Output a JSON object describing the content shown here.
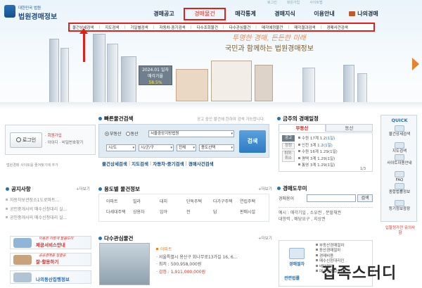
{
  "header": {
    "logo_small": "대한민국 법원",
    "logo_big": "법원경매정보",
    "top_links": [
      "로그인",
      "회원가입",
      "사이트맵"
    ],
    "gnb": [
      "경매공고",
      "경매물건",
      "매각통계",
      "경매지식",
      "이용안내",
      "나의경매"
    ],
    "active_gnb": "경매물건",
    "submenu": [
      "물건상세검색",
      "지도검색",
      "기일별검색",
      "자동차·중기검색",
      "다수조회물건",
      "다수관심물건",
      "매각예정물건",
      "매각결과검색",
      "경매사건검색"
    ],
    "slogan1": "투명한 경매, 든든한 미래",
    "slogan2": "국민과 함께하는 법원경매정보",
    "date_panel": {
      "date": "2024.01 일자",
      "label": "매각가율",
      "value": "58.5%"
    },
    "accent_color": "#e0201a"
  },
  "login": {
    "button": "로그인",
    "join": "· 회원가입",
    "find": "· 아이디 · 비밀번호찾기",
    "note": "법원경매 사이트를 즐겨찾기에 추가"
  },
  "quick_search": {
    "title": "빠른물건검색",
    "hint": "공고 중인 물건에 한하여 검색 가능합니다.",
    "radio": [
      "부동산",
      "동산"
    ],
    "court_select": "서울중앙지방법원",
    "selects": [
      "시/도",
      "시/군/구",
      "전체",
      "용도선택"
    ],
    "search_button": "검색",
    "links": [
      "물건상세검색",
      "지도검색",
      "자동차·중기검색",
      "경매사건검색"
    ]
  },
  "schedule": {
    "title": "금주의 경매일정",
    "tabs": [
      "부동산",
      "동산"
    ],
    "side_tabs": [
      "공고",
      "정정",
      "취하·취소"
    ],
    "rows": [
      {
        "text": "수원 17계 1.2",
        "detail": "(1일)",
        "hl": true
      },
      {
        "text": "인천 3계 1.2",
        "detail": "(1일)",
        "hl": true
      },
      {
        "text": "수원 16계 1.29",
        "detail": "(1일)",
        "hl": false
      },
      {
        "text": "평택 3계 1.29",
        "detail": "(1일)",
        "hl": false
      },
      {
        "text": "통영 3계 1.29",
        "detail": "(1일)",
        "hl": false
      }
    ],
    "pager": "1/3"
  },
  "quick": {
    "title": "QUICK",
    "items": [
      "물건상세검색",
      "지도검색",
      "사이트이용안내",
      "FAQ",
      "종합법률정보",
      "등기정보광장"
    ]
  },
  "notice": {
    "title": "공지사항",
    "more": "+더보기",
    "items": [
      "자동차보관장소1도로마트...",
      "공인중개사의 매수신청대리 실...",
      "공인중개사의 매수신청대리 실..."
    ]
  },
  "banners": [
    {
      "label": "제공서비스안내",
      "sub": "이용은 이렇게 말씀드리",
      "color": "#e0201a"
    },
    {
      "label": "잘·활용하기",
      "sub": "공공경매중 일괄공",
      "color": "#d2342c"
    },
    {
      "label": "나의동산집행정보",
      "sub": "",
      "color": "#2770b5"
    }
  ],
  "usage": {
    "title": "용도별 물건정보",
    "more": "+더보기",
    "items": [
      "아파트",
      "빌라",
      "대지",
      "단독주택",
      "다가구주택",
      "연립주택",
      "다세대주택",
      "상용차",
      "임야",
      "전",
      "답",
      "판매시설"
    ]
  },
  "interest": {
    "title": "다수관심물건",
    "more": "+더보기",
    "type": "아파트",
    "address": "· 서울특별시 용산구 회나무로13가길 16, 6...",
    "min_price_label": "· 최저 : 500,958,000원",
    "appraisal_label": "· 감정 : 1,911,000,000원"
  },
  "dictionary": {
    "title": "경매도우미",
    "label": "경매용어",
    "button": "검색",
    "words_line1": "예시 : 매각기일 , 소유권 , 분할채권",
    "words_line2": "대항력 , 배당요구 , 지상권"
  },
  "guide": {
    "title": "",
    "box": "경매절차",
    "list": [
      "부동산경매절차",
      "동산경매절차",
      "경매비용",
      "매수신청대리인",
      "배당절차",
      "매수신청보증금"
    ],
    "bottom": "관련법률"
  },
  "auction_ex": "입찰정가전 유의사항",
  "watermark": "잡족스터디"
}
